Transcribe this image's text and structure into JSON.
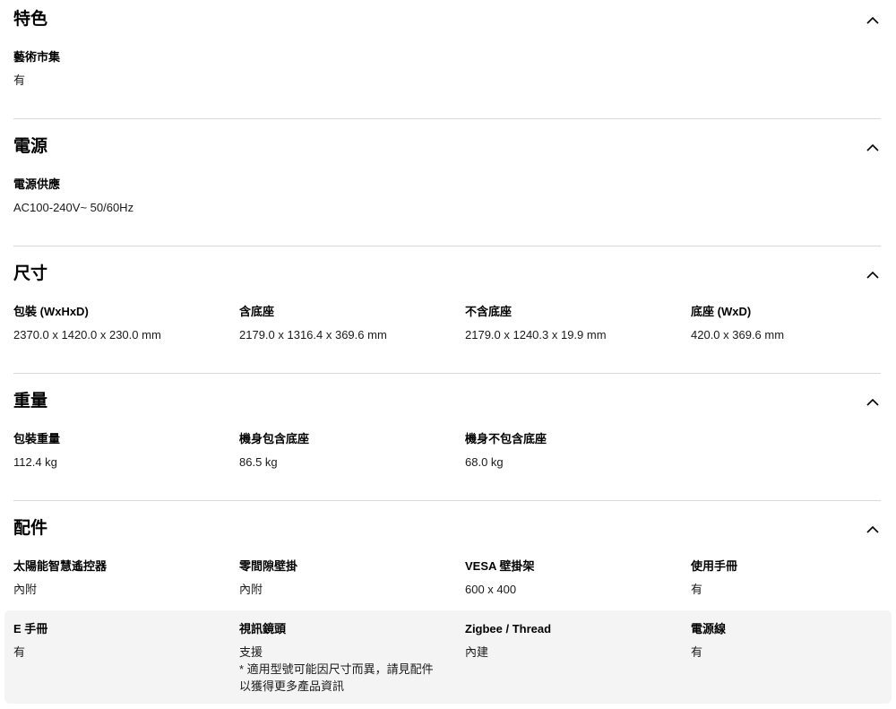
{
  "sections": [
    {
      "title": "特色",
      "specs": [
        {
          "label": "藝術市集",
          "value": "有"
        }
      ]
    },
    {
      "title": "電源",
      "specs": [
        {
          "label": "電源供應",
          "value": "AC100-240V~ 50/60Hz"
        }
      ]
    },
    {
      "title": "尺寸",
      "specs": [
        {
          "label": "包裝 (WxHxD)",
          "value": "2370.0 x 1420.0 x 230.0 mm"
        },
        {
          "label": "含底座",
          "value": "2179.0 x 1316.4 x 369.6 mm"
        },
        {
          "label": "不含底座",
          "value": "2179.0 x 1240.3 x 19.9 mm"
        },
        {
          "label": "底座 (WxD)",
          "value": "420.0 x 369.6 mm"
        }
      ]
    },
    {
      "title": "重量",
      "specs": [
        {
          "label": "包裝重量",
          "value": "112.4 kg"
        },
        {
          "label": "機身包含底座",
          "value": "86.5 kg"
        },
        {
          "label": "機身不包含底座",
          "value": "68.0 kg"
        }
      ]
    },
    {
      "title": "配件",
      "specs": [
        {
          "label": "太陽能智慧遙控器",
          "value": "內附"
        },
        {
          "label": "零間隙壁掛",
          "value": "內附"
        },
        {
          "label": "VESA 壁掛架",
          "value": "600 x 400"
        },
        {
          "label": "使用手冊",
          "value": "有"
        },
        {
          "label": "E 手冊",
          "value": "有"
        },
        {
          "label": "視訊鏡頭",
          "value": "支援",
          "note": "* 適用型號可能因尺寸而異，請見配件以獲得更多產品資訊"
        },
        {
          "label": "Zigbee / Thread",
          "value": "內建"
        },
        {
          "label": "電源線",
          "value": "有"
        }
      ]
    }
  ]
}
